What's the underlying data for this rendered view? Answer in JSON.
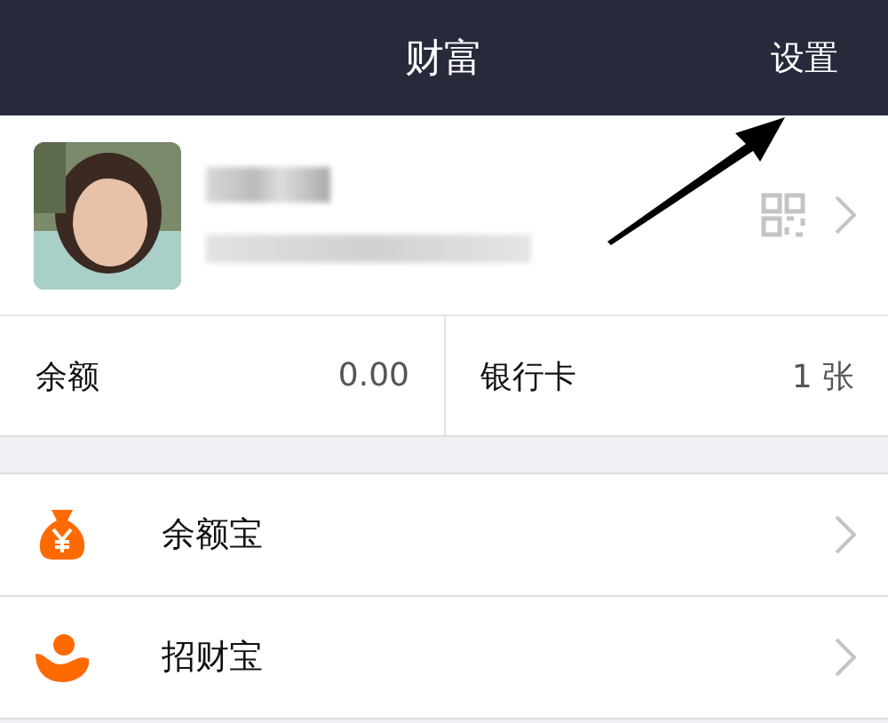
{
  "header": {
    "title": "财富",
    "action": "设置"
  },
  "stats": [
    {
      "label": "余额",
      "value": "0.00"
    },
    {
      "label": "银行卡",
      "value": "1 张"
    }
  ],
  "menu": [
    {
      "kind": "money-bag",
      "label": "余额宝"
    },
    {
      "kind": "bowl",
      "label": "招财宝"
    }
  ]
}
